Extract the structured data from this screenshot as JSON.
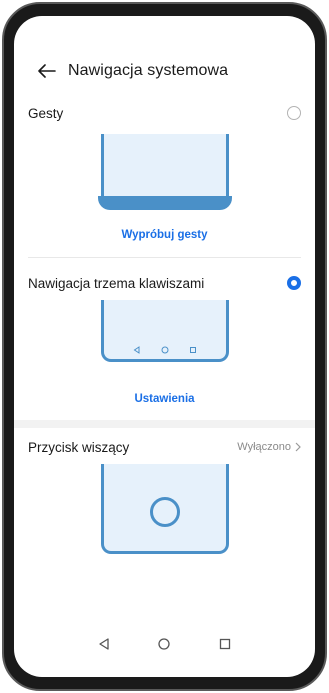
{
  "header": {
    "title": "Nawigacja systemowa",
    "back_icon": "arrow-left-icon"
  },
  "options": [
    {
      "label": "Gesty",
      "selected": false,
      "action_label": "Wypróbuj gesty"
    },
    {
      "label": "Nawigacja trzema klawiszami",
      "selected": true,
      "action_label": "Ustawienia"
    }
  ],
  "floating_button": {
    "label": "Przycisk wiszący",
    "value": "Wyłączono"
  },
  "colors": {
    "accent": "#1a6fe6",
    "illustration_border": "#4a90c8",
    "illustration_fill": "#e6f1fb"
  },
  "system_nav": {
    "back_icon": "triangle-back-icon",
    "home_icon": "circle-home-icon",
    "recents_icon": "square-recents-icon"
  }
}
